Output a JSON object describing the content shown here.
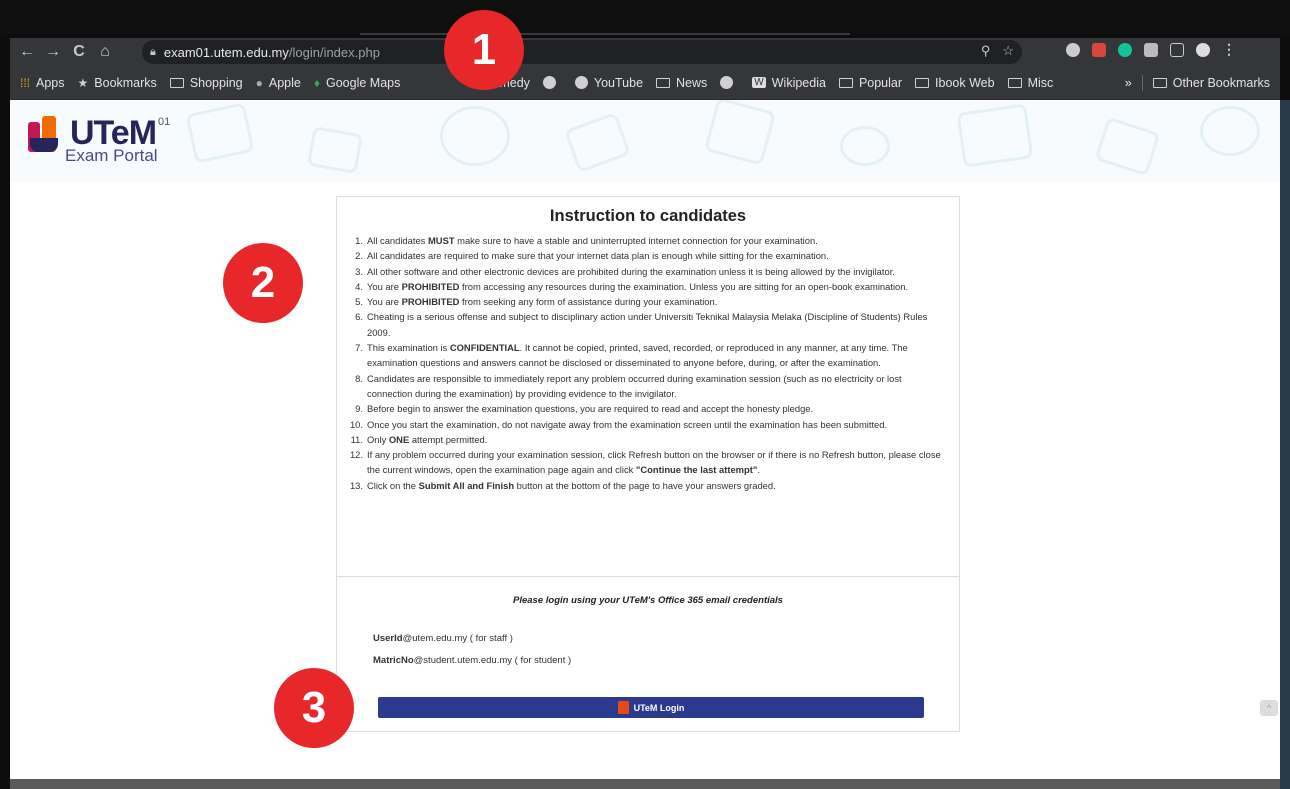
{
  "browser": {
    "url_host": "exam01.utem.edu.my",
    "url_path": "/login/index.php",
    "bookmarks": [
      {
        "label": "Apps",
        "icon": "apps-icon"
      },
      {
        "label": "Bookmarks",
        "icon": "star-icon"
      },
      {
        "label": "Shopping",
        "icon": "folder-icon"
      },
      {
        "label": "Apple",
        "icon": "apple-icon"
      },
      {
        "label": "Google Maps",
        "icon": "maps-pin-icon"
      },
      {
        "label": "Comedy",
        "icon": "youtube-icon"
      },
      {
        "label": "",
        "icon": "globe-icon"
      },
      {
        "label": "YouTube",
        "icon": "globe-icon"
      },
      {
        "label": "News",
        "icon": "folder-icon"
      },
      {
        "label": "",
        "icon": "globe-icon"
      },
      {
        "label": "Wikipedia",
        "icon": "wikipedia-icon"
      },
      {
        "label": "Popular",
        "icon": "folder-icon"
      },
      {
        "label": "Ibook Web",
        "icon": "folder-icon"
      },
      {
        "label": "Misc",
        "icon": "folder-icon"
      }
    ],
    "overflow": "»",
    "other_bookmarks": "Other Bookmarks"
  },
  "portal": {
    "logo_text": "UTeM",
    "logo_sup": "01",
    "logo_sub": "Exam Portal"
  },
  "instructions": {
    "title": "Instruction to candidates",
    "items": [
      {
        "num": "1.",
        "text": "All candidates **MUST** make sure to have a stable and uninterrupted internet connection for your examination."
      },
      {
        "num": "2.",
        "text": "All candidates are required to make sure that your internet data plan is enough while sitting for the examination."
      },
      {
        "num": "3.",
        "text": "All other software and other electronic devices are prohibited during the examination unless it is being allowed by the invigilator."
      },
      {
        "num": "4.",
        "text": "You are **PROHIBITED** from accessing any resources during the examination. Unless you are sitting for an open-book examination."
      },
      {
        "num": "5.",
        "text": "You are **PROHIBITED** from seeking any form of assistance during your examination."
      },
      {
        "num": "6.",
        "text": "Cheating is a serious offense and subject to disciplinary action under Universiti Teknikal Malaysia Melaka (Discipline of Students) Rules 2009."
      },
      {
        "num": "7.",
        "text": "This examination is **CONFIDENTIAL**. It cannot be copied, printed, saved, recorded, or reproduced in any manner, at any time. The examination questions and answers cannot be disclosed or disseminated to anyone before, during, or after the examination."
      },
      {
        "num": "8.",
        "text": "Candidates are responsible to immediately report any problem occurred during examination session (such as no electricity or lost connection during the examination) by providing evidence to the invigilator."
      },
      {
        "num": "9.",
        "text": "Before begin to answer the examination questions, you are required to read and accept the honesty pledge."
      },
      {
        "num": "10.",
        "text": "Once you start the examination, do not navigate away from the examination screen until the examination has been submitted."
      },
      {
        "num": "11.",
        "text": "Only **ONE** attempt permitted."
      },
      {
        "num": "12.",
        "text": "If any problem occurred during your examination session, click Refresh button on the browser or if there is no Refresh button, please close the current windows, open the examination page again and click **\"Continue the last attempt\"**."
      },
      {
        "num": "13.",
        "text": "Click on the **Submit All and Finish** button at the bottom of the page to have your answers graded."
      }
    ]
  },
  "login": {
    "note": "Please login using your UTeM's Office 365 email credentials",
    "staff_bold": "UserId",
    "staff_rest": "@utem.edu.my ( for staff )",
    "student_bold": "MatricNo",
    "student_rest": "@student.utem.edu.my ( for student )",
    "button_label": "UTeM Login"
  },
  "markers": [
    "1",
    "2",
    "3"
  ],
  "colors": {
    "marker": "#e8272a",
    "login_button": "#2b3a8c",
    "office_icon": "#e64a19"
  }
}
